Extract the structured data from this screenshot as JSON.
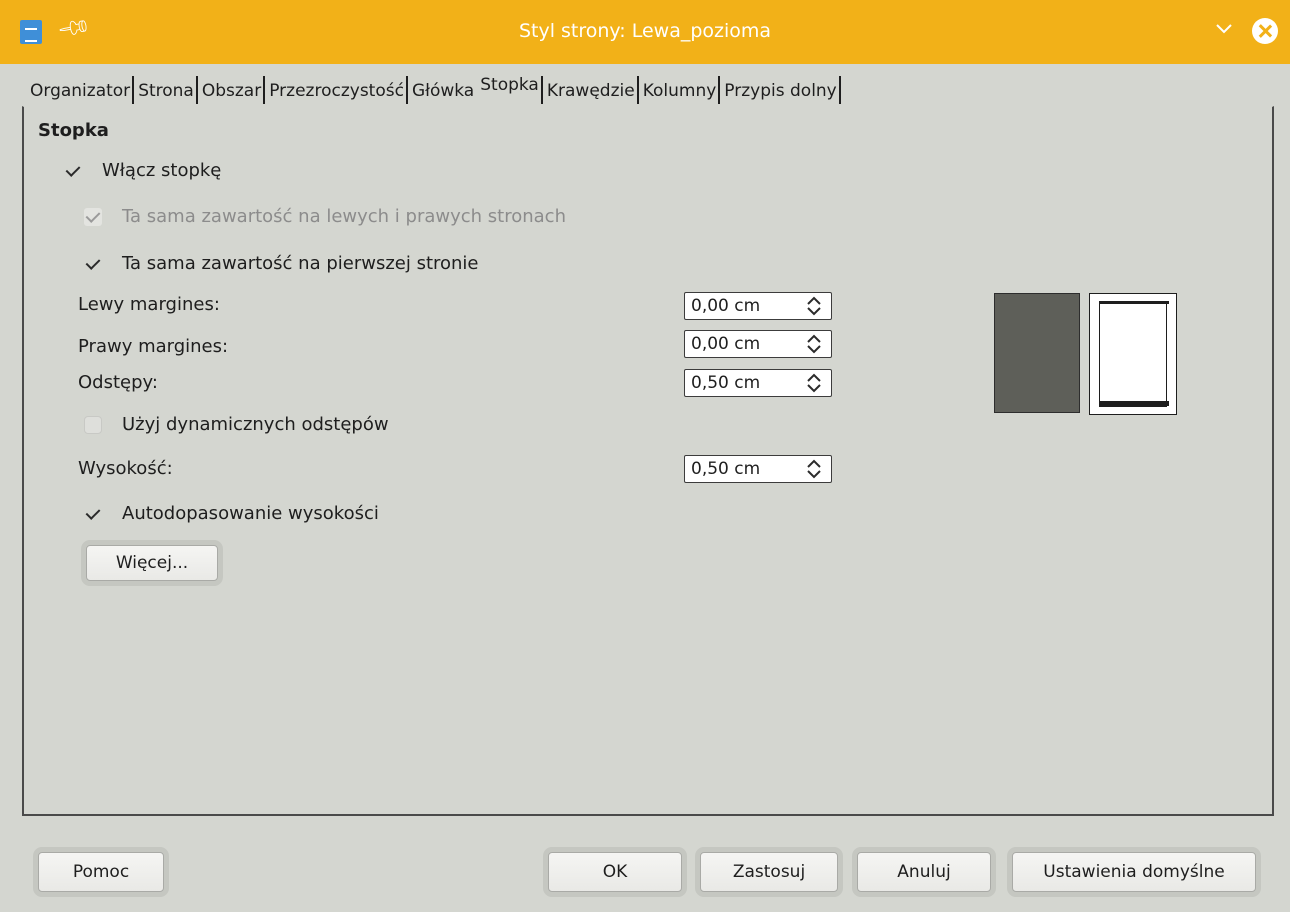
{
  "window": {
    "title": "Styl strony: Lewa_pozioma"
  },
  "tabs": [
    {
      "label": "Organizator"
    },
    {
      "label": "Strona"
    },
    {
      "label": "Obszar"
    },
    {
      "label": "Przezroczystość"
    },
    {
      "label": "Główka"
    },
    {
      "label": "Stopka"
    },
    {
      "label": "Krawędzie"
    },
    {
      "label": "Kolumny"
    },
    {
      "label": "Przypis dolny"
    }
  ],
  "active_tab": "Stopka",
  "footer": {
    "section_title": "Stopka",
    "enable_footer": {
      "label": "Włącz stopkę",
      "checked": true
    },
    "same_left_right": {
      "label": "Ta sama zawartość na lewych i prawych stronach",
      "checked": true,
      "enabled": false
    },
    "same_first_page": {
      "label": "Ta sama zawartość na pierwszej stronie",
      "checked": true
    },
    "left_margin": {
      "label": "Lewy margines:",
      "value": "0,00 cm"
    },
    "right_margin": {
      "label": "Prawy margines:",
      "value": "0,00 cm"
    },
    "spacing": {
      "label": "Odstępy:",
      "value": "0,50 cm"
    },
    "dynamic_spacing": {
      "label": "Użyj dynamicznych odstępów",
      "checked": false
    },
    "height": {
      "label": "Wysokość:",
      "value": "0,50 cm"
    },
    "autofit_height": {
      "label": "Autodopasowanie wysokości",
      "checked": true
    },
    "more_button": "Więcej..."
  },
  "buttons": {
    "help": "Pomoc",
    "ok": "OK",
    "apply": "Zastosuj",
    "cancel": "Anuluj",
    "defaults": "Ustawienia domyślne"
  },
  "colors": {
    "titlebar": "#f2b118",
    "background": "#d4d6d0",
    "preview_page": "#5e5f59"
  }
}
